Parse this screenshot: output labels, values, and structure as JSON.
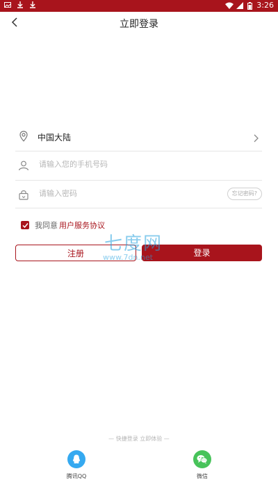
{
  "status_bar": {
    "time": "3:26"
  },
  "header": {
    "title": "立即登录"
  },
  "region": {
    "value": "中国大陆"
  },
  "phone": {
    "placeholder": "请输入您的手机号码"
  },
  "password": {
    "placeholder": "请输入密码",
    "forgot_label": "忘记密码?"
  },
  "agreement": {
    "prefix": "我同意",
    "link": "用户服务协议",
    "checked": true
  },
  "buttons": {
    "register": "注册",
    "login": "登录"
  },
  "watermark": {
    "brand": "七度网",
    "url": "www.7dn.net"
  },
  "quick_login": {
    "tip": "— 快捷登录 立即体验 —",
    "options": [
      {
        "label": "腾讯QQ",
        "icon": "qq-icon",
        "color": "#35a9f0"
      },
      {
        "label": "微信",
        "icon": "wechat-icon",
        "color": "#47c35a"
      }
    ]
  },
  "colors": {
    "accent": "#a8141c"
  }
}
